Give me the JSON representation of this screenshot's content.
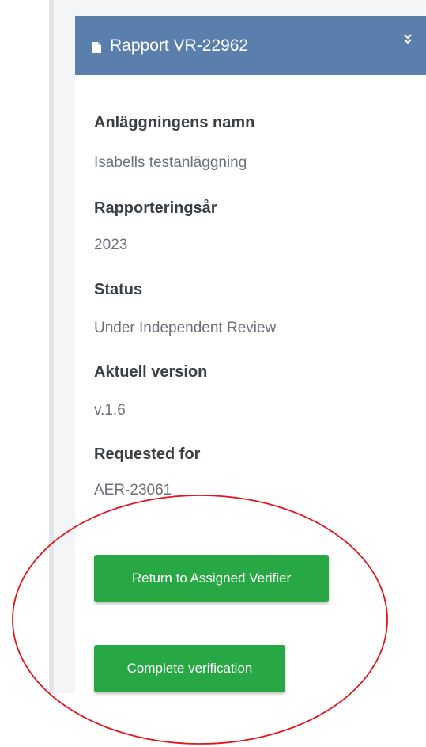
{
  "header": {
    "title": "Rapport VR-22962",
    "icon": "document-icon",
    "collapse_icon": "double-chevron-down-icon",
    "color": "#5b7fac"
  },
  "fields": [
    {
      "label": "Anläggningens namn",
      "value": "Isabells testanläggning"
    },
    {
      "label": "Rapporteringsår",
      "value": "2023"
    },
    {
      "label": "Status",
      "value": "Under Independent Review"
    },
    {
      "label": "Aktuell version",
      "value": "v.1.6"
    },
    {
      "label": "Requested for",
      "value": "AER-23061"
    }
  ],
  "actions": {
    "return_label": "Return to Assigned Verifier",
    "complete_label": "Complete verification",
    "button_color": "#27a844"
  },
  "annotation": {
    "shape": "ellipse",
    "color": "#e3131b"
  }
}
